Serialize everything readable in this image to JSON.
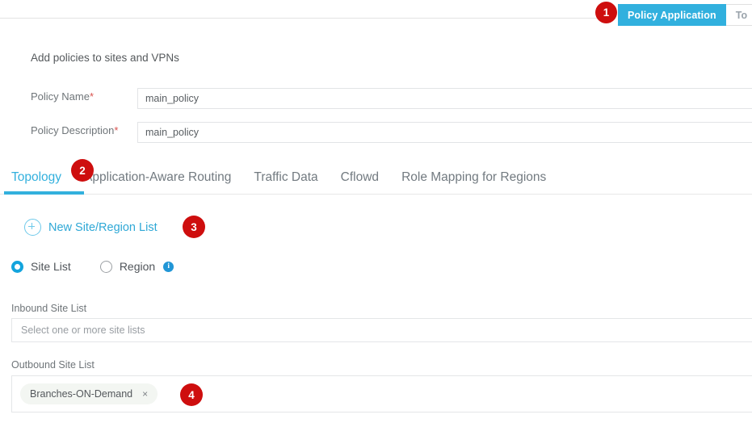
{
  "top_bar": {
    "tabs": [
      {
        "label": "Policy Application",
        "active": true
      },
      {
        "label": "To",
        "active": false
      }
    ]
  },
  "headline": "Add policies to sites and VPNs",
  "form": {
    "policy_name": {
      "label": "Policy Name",
      "required_marker": "*",
      "value": "main_policy",
      "placeholder": ""
    },
    "policy_description": {
      "label": "Policy Description",
      "required_marker": "*",
      "value": "main_policy",
      "placeholder": ""
    }
  },
  "tabs": [
    {
      "label": "Topology",
      "active": true
    },
    {
      "label": "Application-Aware Routing",
      "active": false
    },
    {
      "label": "Traffic Data",
      "active": false
    },
    {
      "label": "Cflowd",
      "active": false
    },
    {
      "label": "Role Mapping for Regions",
      "active": false
    }
  ],
  "new_list": {
    "icon": "plus-circle-icon",
    "label": "New Site/Region List"
  },
  "scope_radio": {
    "options": [
      {
        "label": "Site List",
        "selected": true
      },
      {
        "label": "Region",
        "selected": false
      }
    ],
    "info_icon_glyph": "i"
  },
  "inbound": {
    "label": "Inbound Site List",
    "placeholder": "Select one or more site lists",
    "value": ""
  },
  "outbound": {
    "label": "Outbound Site List",
    "chips": [
      {
        "label": "Branches-ON-Demand",
        "remove_glyph": "×"
      }
    ]
  },
  "step_badges": [
    {
      "number": "1"
    },
    {
      "number": "2"
    },
    {
      "number": "3"
    },
    {
      "number": "4"
    }
  ],
  "colors": {
    "accent_blue": "#31b0de",
    "link_blue": "#2fa8d6",
    "badge_red": "#ce0e0e",
    "required_red": "#d9534f",
    "chip_bg": "#f3f6f2",
    "border_gray": "#e2e4e6"
  }
}
